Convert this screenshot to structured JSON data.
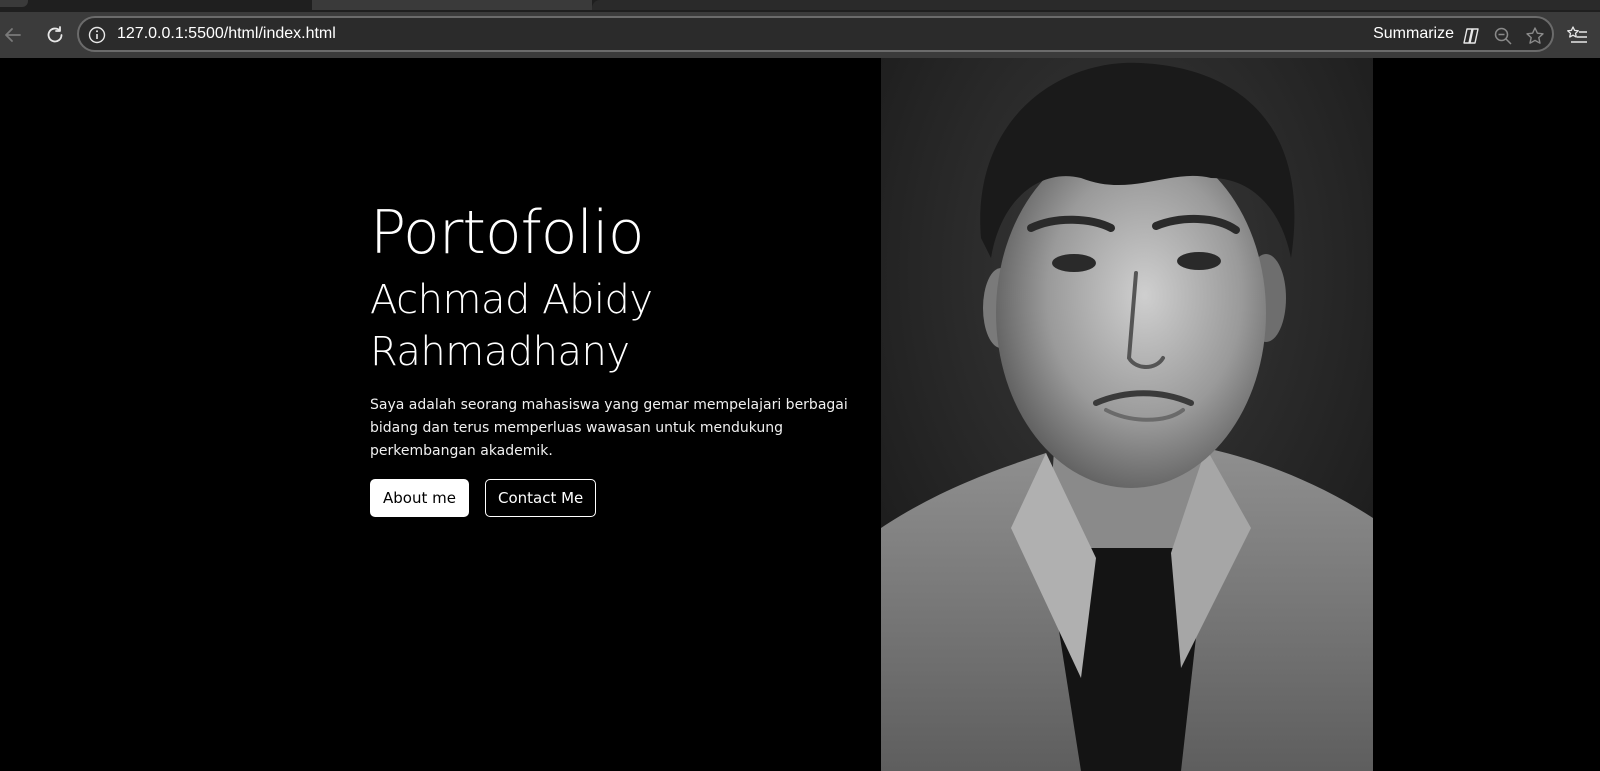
{
  "browser": {
    "url": "127.0.0.1:5500/html/index.html",
    "summarize_label": "Summarize"
  },
  "hero": {
    "title": "Portofolio",
    "name": "Achmad Abidy Rahmadhany",
    "description": "Saya adalah seorang mahasiswa yang gemar mempelajari berbagai bidang dan terus memperluas wawasan untuk mendukung perkembangan akademik.",
    "about_label": "About me",
    "contact_label": "Contact Me"
  },
  "colors": {
    "page_bg": "#000000",
    "text": "#ffffff",
    "toolbar_bg": "#3b3b3b"
  },
  "icons": [
    "back-arrow-icon",
    "reload-icon",
    "info-icon",
    "copilot-icon",
    "zoom-out-icon",
    "star-icon",
    "favorites-icon"
  ]
}
